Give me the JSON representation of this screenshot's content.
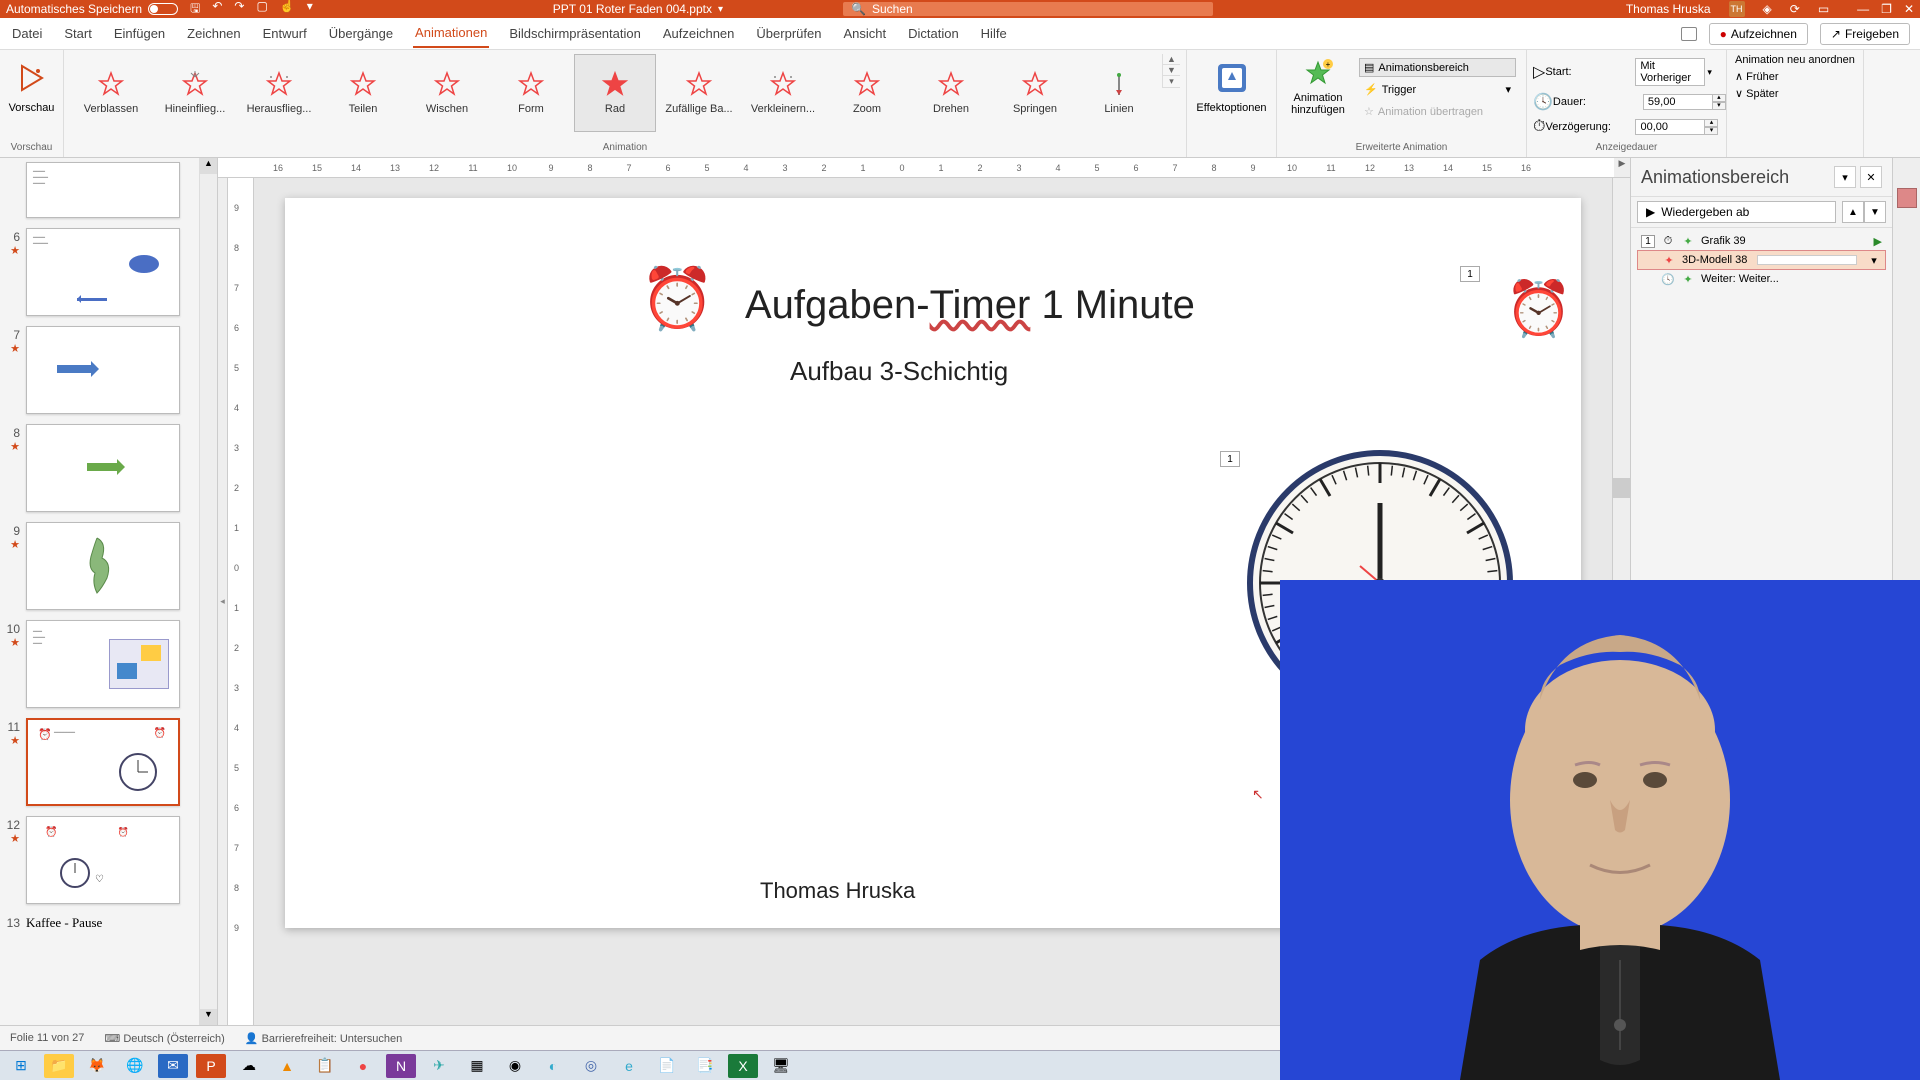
{
  "titlebar": {
    "autosave": "Automatisches Speichern",
    "filename": "PPT 01 Roter Faden 004.pptx",
    "search_placeholder": "Suchen",
    "username": "Thomas Hruska",
    "initials": "TH"
  },
  "tabs": {
    "datei": "Datei",
    "start": "Start",
    "einfuegen": "Einfügen",
    "zeichnen": "Zeichnen",
    "entwurf": "Entwurf",
    "uebergaenge": "Übergänge",
    "animationen": "Animationen",
    "bildschirm": "Bildschirmpräsentation",
    "aufzeichnen": "Aufzeichnen",
    "ueberpruefen": "Überprüfen",
    "ansicht": "Ansicht",
    "dictation": "Dictation",
    "hilfe": "Hilfe",
    "aufzeichnen_btn": "Aufzeichnen",
    "freigeben": "Freigeben"
  },
  "ribbon": {
    "vorschau": "Vorschau",
    "animation_group": "Animation",
    "erweiterte": "Erweiterte Animation",
    "anzeigedauer": "Anzeigedauer",
    "gallery": {
      "verblassen": "Verblassen",
      "hineinflieg": "Hineinflieg...",
      "herausflieg": "Herausflieg...",
      "teilen": "Teilen",
      "wischen": "Wischen",
      "form": "Form",
      "rad": "Rad",
      "zufaellig": "Zufällige Ba...",
      "verkleinern": "Verkleinern...",
      "zoom": "Zoom",
      "drehen": "Drehen",
      "springen": "Springen",
      "linien": "Linien"
    },
    "effektoptionen": "Effektoptionen",
    "anim_hinzu": "Animation hinzufügen",
    "animationsbereich": "Animationsbereich",
    "trigger": "Trigger",
    "anim_uebertragen": "Animation übertragen",
    "start_lbl": "Start:",
    "start_val": "Mit Vorheriger",
    "dauer_lbl": "Dauer:",
    "dauer_val": "59,00",
    "verzoegerung_lbl": "Verzögerung:",
    "verzoegerung_val": "00,00",
    "reorder_title": "Animation neu anordnen",
    "frueher": "Früher",
    "spaeter": "Später"
  },
  "ruler_h": [
    "16",
    "15",
    "14",
    "13",
    "12",
    "11",
    "10",
    "9",
    "8",
    "7",
    "6",
    "5",
    "4",
    "3",
    "2",
    "1",
    "0",
    "1",
    "2",
    "3",
    "4",
    "5",
    "6",
    "7",
    "8",
    "9",
    "10",
    "11",
    "12",
    "13",
    "14",
    "15",
    "16"
  ],
  "ruler_v": [
    "9",
    "8",
    "7",
    "6",
    "5",
    "4",
    "3",
    "2",
    "1",
    "0",
    "1",
    "2",
    "3",
    "4",
    "5",
    "6",
    "7",
    "8",
    "9"
  ],
  "thumbs": [
    {
      "num": "6"
    },
    {
      "num": "7"
    },
    {
      "num": "8"
    },
    {
      "num": "9"
    },
    {
      "num": "10"
    },
    {
      "num": "11"
    },
    {
      "num": "12"
    },
    {
      "num": "13"
    }
  ],
  "thumb13_text": "Kaffee - Pause",
  "slide": {
    "title_pre": "Aufgaben-",
    "title_uline": "Timer",
    "title_post": " 1 Minute",
    "subtitle": "Aufbau 3-Schichtig",
    "author": "Thomas Hruska",
    "tag1": "1",
    "tag2": "1"
  },
  "animpane": {
    "title": "Animationsbereich",
    "play": "Wiedergeben ab",
    "items": [
      {
        "num": "1",
        "name": "Grafik 39"
      },
      {
        "num": "",
        "name": "3D-Modell 38"
      },
      {
        "num": "",
        "name": "Weiter: Weiter..."
      }
    ]
  },
  "statusbar": {
    "slide": "Folie 11 von 27",
    "lang": "Deutsch (Österreich)",
    "access": "Barrierefreiheit: Untersuchen"
  }
}
